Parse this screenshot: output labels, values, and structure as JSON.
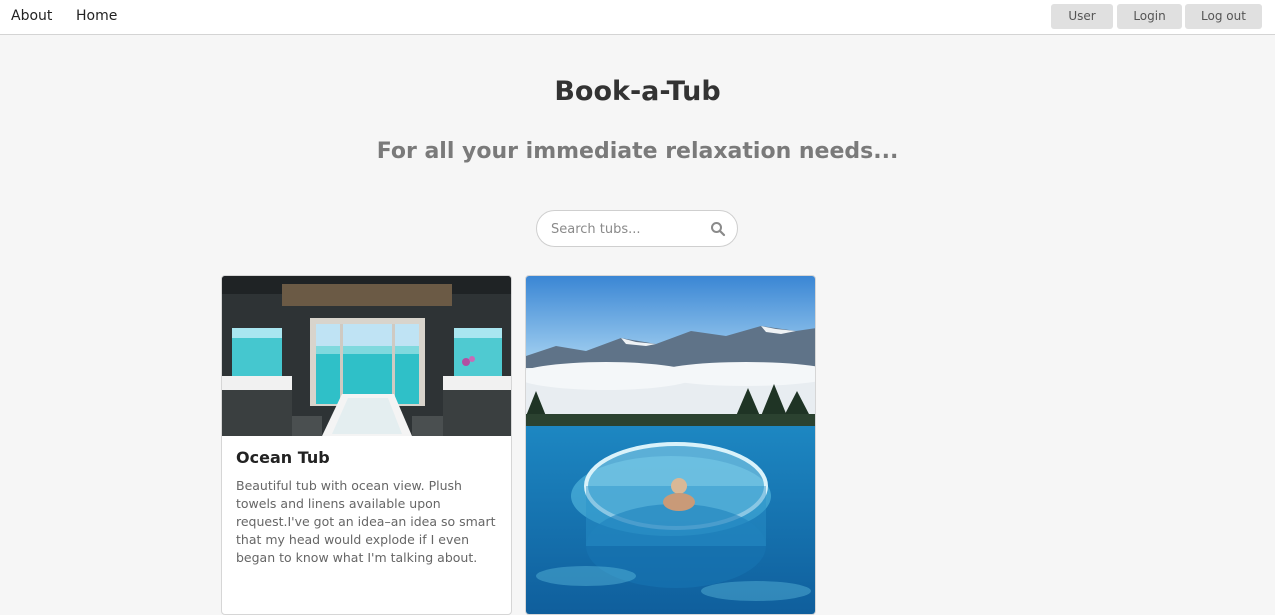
{
  "nav": {
    "links": [
      {
        "label": "About"
      },
      {
        "label": "Home"
      }
    ],
    "buttons": [
      {
        "label": "User"
      },
      {
        "label": "Login"
      },
      {
        "label": "Log out"
      }
    ]
  },
  "hero": {
    "title": "Book-a-Tub",
    "subtitle": "For all your immediate relaxation needs..."
  },
  "search": {
    "placeholder": "Search tubs...",
    "value": "",
    "icon": "search-icon"
  },
  "cards": [
    {
      "image": "ocean-bathroom-photo",
      "title": "Ocean Tub",
      "description": "Beautiful tub with ocean view. Plush towels and linens available upon request.I've got an idea–an idea so smart that my head would explode if I even began to know what I'm talking about."
    },
    {
      "image": "mountain-infinity-pool-photo",
      "title": "",
      "description": ""
    }
  ],
  "colors": {
    "background": "#f6f6f6",
    "topbar": "#ffffff",
    "button_bg": "#e0e0e0",
    "title": "#333333",
    "subtitle": "#7a7a7a"
  }
}
